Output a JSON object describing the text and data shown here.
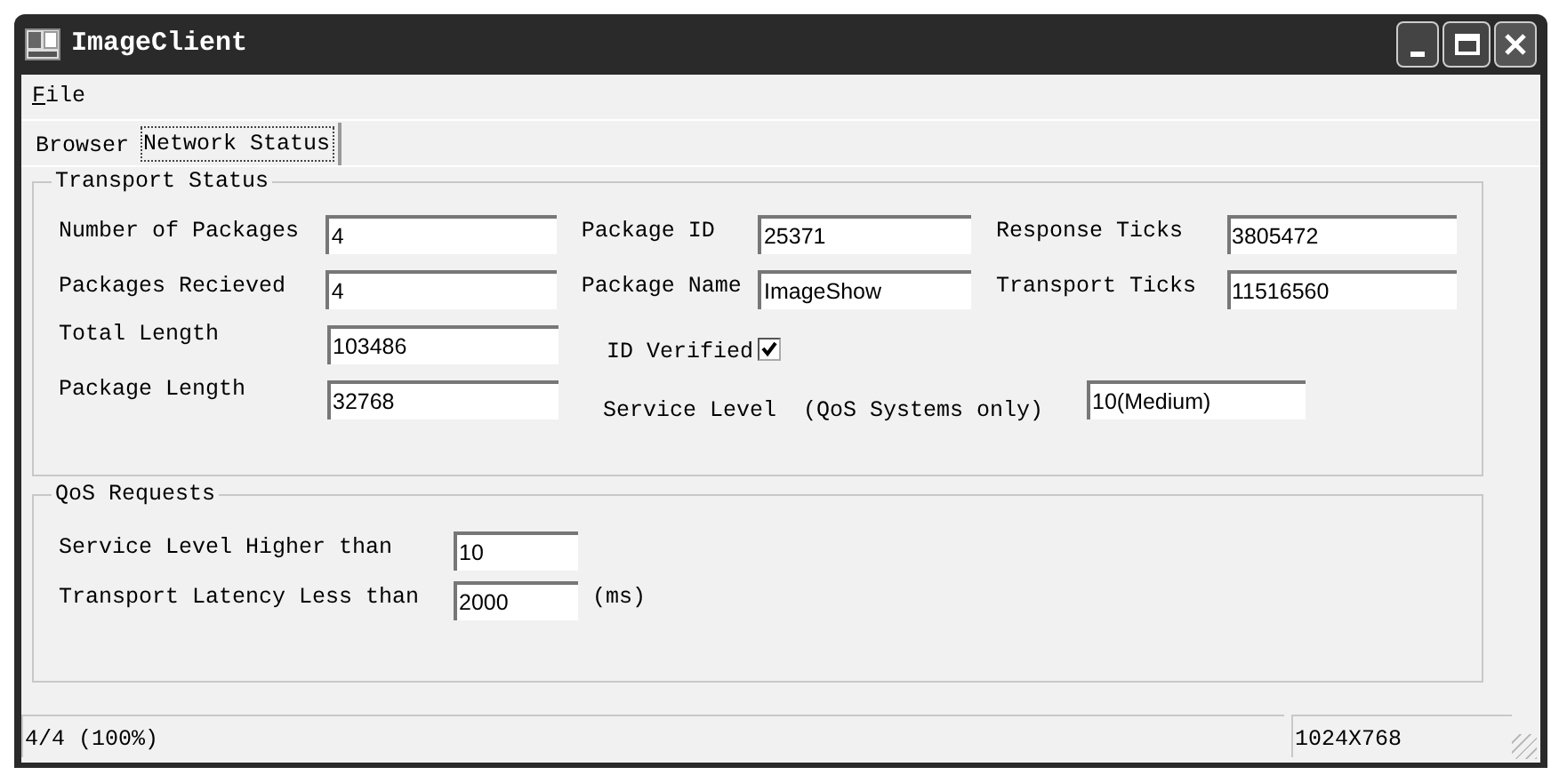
{
  "window": {
    "title": "ImageClient"
  },
  "menu": [
    {
      "label": "File"
    }
  ],
  "tabs": [
    {
      "label": "Browser",
      "selected": false
    },
    {
      "label": "Network Status",
      "selected": true
    }
  ],
  "transport_status": {
    "title": "Transport Status",
    "rows": [
      [
        {
          "kind": "field",
          "label": "Number of Packages",
          "value": "4"
        },
        {
          "kind": "field",
          "label": "Package ID",
          "value": "25371"
        },
        {
          "kind": "field",
          "label": "Response Ticks",
          "value": "3805472"
        }
      ],
      [
        {
          "kind": "field",
          "label": "Packages Recieved",
          "value": "4"
        },
        {
          "kind": "field",
          "label": "Package Name",
          "value": "ImageShow"
        },
        {
          "kind": "field",
          "label": "Transport Ticks",
          "value": "11516560"
        }
      ],
      [
        {
          "kind": "field",
          "label": "Total Length",
          "value": "103486"
        },
        {
          "kind": "checkbox",
          "label": "ID Verified",
          "checked": true
        }
      ],
      [
        {
          "kind": "field",
          "label": "Package Length",
          "value": "32768"
        },
        {
          "kind": "field",
          "label": "Service Level  (QoS Systems only)",
          "value": "10(Medium)"
        }
      ]
    ]
  },
  "qos_requests": {
    "title": "QoS Requests",
    "rows": [
      {
        "label": "Service Level Higher than",
        "value": "10"
      },
      {
        "label": "Transport Latency Less than",
        "value": "2000",
        "unit": "(ms)"
      }
    ]
  },
  "status_bar": [
    "4/4 (100%)",
    "1024X768"
  ]
}
